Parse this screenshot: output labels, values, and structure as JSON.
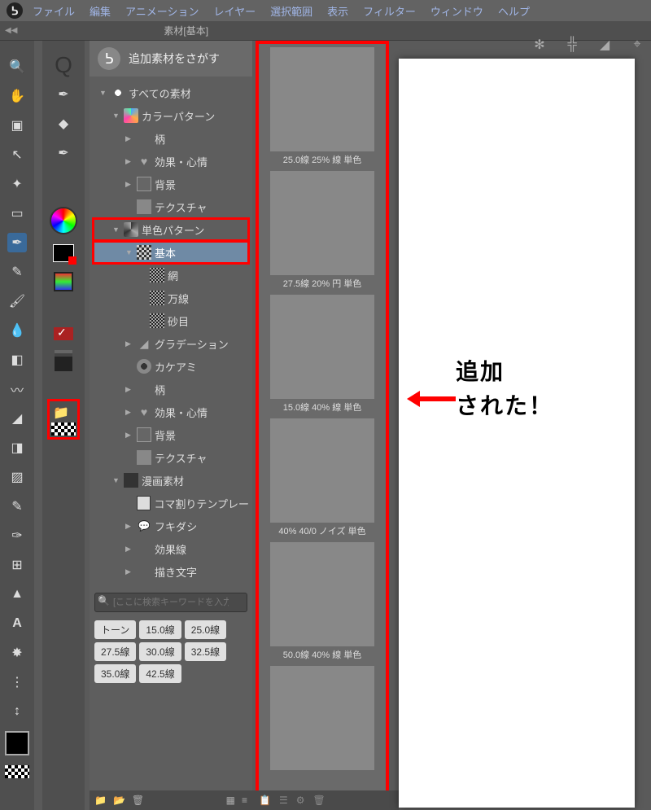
{
  "menubar": {
    "items": [
      "ファイル",
      "編集",
      "アニメーション",
      "レイヤー",
      "選択範囲",
      "表示",
      "フィルター",
      "ウィンドウ",
      "ヘルプ"
    ]
  },
  "panel": {
    "title": "素材[基本]",
    "header_label": "追加素材をさがす",
    "search_placeholder": "[ここに検索キーワードを入力して"
  },
  "tree": [
    {
      "indent": 0,
      "arrow": "▼",
      "icon": "ic-all",
      "label": "すべての素材"
    },
    {
      "indent": 1,
      "arrow": "▼",
      "icon": "ic-colorpat",
      "label": "カラーパターン"
    },
    {
      "indent": 2,
      "arrow": "▶",
      "icon": "ic-pat",
      "label": "柄"
    },
    {
      "indent": 2,
      "arrow": "▶",
      "icon": "ic-heart",
      "label": "効果・心情"
    },
    {
      "indent": 2,
      "arrow": "▶",
      "icon": "ic-bg",
      "label": "背景"
    },
    {
      "indent": 2,
      "arrow": "",
      "icon": "ic-tex",
      "label": "テクスチャ"
    },
    {
      "indent": 1,
      "arrow": "▼",
      "icon": "ic-mono",
      "label": "単色パターン",
      "highlight": true
    },
    {
      "indent": 2,
      "arrow": "▼",
      "icon": "ic-basic",
      "label": "基本",
      "selected": true,
      "highlight": true
    },
    {
      "indent": 3,
      "arrow": "",
      "icon": "ic-net",
      "label": "網"
    },
    {
      "indent": 3,
      "arrow": "",
      "icon": "ic-net",
      "label": "万線"
    },
    {
      "indent": 3,
      "arrow": "",
      "icon": "ic-net",
      "label": "砂目"
    },
    {
      "indent": 2,
      "arrow": "▶",
      "icon": "ic-grad",
      "label": "グラデーション"
    },
    {
      "indent": 2,
      "arrow": "",
      "icon": "ic-kake",
      "label": "カケアミ"
    },
    {
      "indent": 2,
      "arrow": "▶",
      "icon": "ic-pat",
      "label": "柄"
    },
    {
      "indent": 2,
      "arrow": "▶",
      "icon": "ic-heart",
      "label": "効果・心情"
    },
    {
      "indent": 2,
      "arrow": "▶",
      "icon": "ic-bg",
      "label": "背景"
    },
    {
      "indent": 2,
      "arrow": "",
      "icon": "ic-tex",
      "label": "テクスチャ"
    },
    {
      "indent": 1,
      "arrow": "▼",
      "icon": "ic-manga",
      "label": "漫画素材"
    },
    {
      "indent": 2,
      "arrow": "",
      "icon": "ic-koma",
      "label": "コマ割りテンプレー"
    },
    {
      "indent": 2,
      "arrow": "▶",
      "icon": "ic-fuki",
      "label": "フキダシ"
    },
    {
      "indent": 2,
      "arrow": "▶",
      "icon": "ic-fx",
      "label": "効果線"
    },
    {
      "indent": 2,
      "arrow": "▶",
      "icon": "ic-fx",
      "label": "描き文字"
    }
  ],
  "tags": [
    "トーン",
    "15.0線",
    "25.0線",
    "27.5線",
    "30.0線",
    "32.5線",
    "35.0線",
    "42.5線"
  ],
  "thumbs": [
    {
      "cls": "p-vlines",
      "label": "25.0線 25% 線 単色"
    },
    {
      "cls": "p-dots",
      "label": "27.5線 20% 円 単色"
    },
    {
      "cls": "p-vthick",
      "label": "15.0線 40% 線 単色"
    },
    {
      "cls": "p-noise",
      "label": "40% 40/0 ノイズ 単色"
    },
    {
      "cls": "p-vthin",
      "label": "50.0線 40% 線 単色"
    },
    {
      "cls": "p-cross",
      "label": ""
    }
  ],
  "annotation": {
    "line1": "追加",
    "line2": "された！"
  }
}
